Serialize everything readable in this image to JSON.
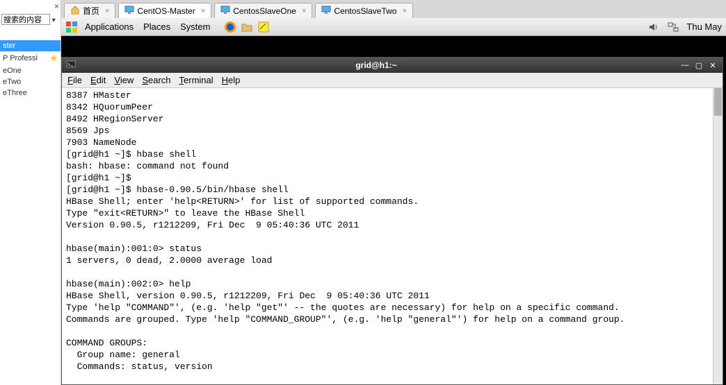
{
  "left": {
    "search_placeholder": "搜索的内容",
    "items": [
      {
        "label": "ster",
        "sel": true,
        "star": false
      },
      {
        "label": "P Professi",
        "sel": false,
        "star": true
      },
      {
        "label": "eOne",
        "sel": false,
        "star": false
      },
      {
        "label": "eTwo",
        "sel": false,
        "star": false
      },
      {
        "label": "eThree",
        "sel": false,
        "star": false
      }
    ]
  },
  "tabs": [
    {
      "label": "首页",
      "icon": "house",
      "active": false
    },
    {
      "label": "CentOS-Master",
      "icon": "monitor",
      "active": true
    },
    {
      "label": "CentosSlaveOne",
      "icon": "monitor",
      "active": false
    },
    {
      "label": "CentosSlaveTwo",
      "icon": "monitor",
      "active": false
    }
  ],
  "gnome": {
    "menus": [
      "Applications",
      "Places",
      "System"
    ],
    "clock": "Thu May"
  },
  "term": {
    "title": "grid@h1:~",
    "menus": [
      {
        "u": "F",
        "rest": "ile"
      },
      {
        "u": "E",
        "rest": "dit"
      },
      {
        "u": "V",
        "rest": "iew"
      },
      {
        "u": "S",
        "rest": "earch"
      },
      {
        "u": "T",
        "rest": "erminal"
      },
      {
        "u": "H",
        "rest": "elp"
      }
    ],
    "lines": [
      "8387 HMaster",
      "8342 HQuorumPeer",
      "8492 HRegionServer",
      "8569 Jps",
      "7903 NameNode",
      "[grid@h1 ~]$ hbase shell",
      "bash: hbase: command not found",
      "[grid@h1 ~]$",
      "[grid@h1 ~]$ hbase-0.90.5/bin/hbase shell",
      "HBase Shell; enter 'help<RETURN>' for list of supported commands.",
      "Type \"exit<RETURN>\" to leave the HBase Shell",
      "Version 0.90.5, r1212209, Fri Dec  9 05:40:36 UTC 2011",
      "",
      "hbase(main):001:0> status",
      "1 servers, 0 dead, 2.0000 average load",
      "",
      "hbase(main):002:0> help",
      "HBase Shell, version 0.90.5, r1212209, Fri Dec  9 05:40:36 UTC 2011",
      "Type 'help \"COMMAND\"', (e.g. 'help \"get\"' -- the quotes are necessary) for help on a specific command.",
      "Commands are grouped. Type 'help \"COMMAND_GROUP\"', (e.g. 'help \"general\"') for help on a command group.",
      "",
      "COMMAND GROUPS:",
      "  Group name: general",
      "  Commands: status, version"
    ]
  }
}
